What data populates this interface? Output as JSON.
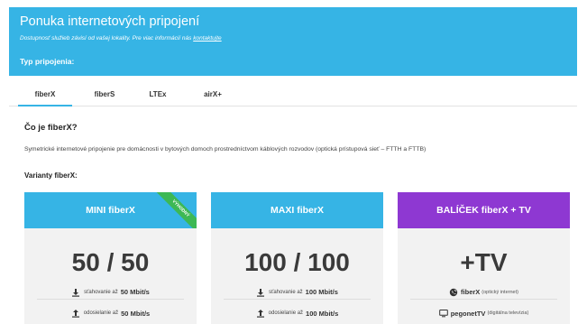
{
  "hero": {
    "title": "Ponuka internetových pripojení",
    "subtitle": "Dostupnosť služieb závisí od vašej lokality. Pre viac informácií nás",
    "contact_link": "kontaktujte",
    "type_label": "Typ pripojenia:"
  },
  "tabs": [
    {
      "label": "fiberX",
      "active": true
    },
    {
      "label": "fiberS",
      "active": false
    },
    {
      "label": "LTEx",
      "active": false
    },
    {
      "label": "airX+",
      "active": false
    }
  ],
  "content": {
    "heading": "Čo je fiberX?",
    "description": "Symetrické internetové pripojenie pre domácnosti v bytových domoch prostredníctvom káblových rozvodov (optická prístupová sieť – FTTH a FTTB)",
    "variants_label": "Varianty fiberX:"
  },
  "cards": [
    {
      "title": "MINI fiberX",
      "ribbon": "VÝHODNÝ",
      "big": "50 / 50",
      "color": "#36b4e5",
      "f1_label": "sťahovanie až",
      "f1_value": "50 Mbit/s",
      "f2_label": "odosielanie až",
      "f2_value": "50 Mbit/s"
    },
    {
      "title": "MAXI fiberX",
      "big": "100 / 100",
      "color": "#36b4e5",
      "f1_label": "sťahovanie až",
      "f1_value": "100 Mbit/s",
      "f2_label": "odosielanie až",
      "f2_value": "100 Mbit/s"
    },
    {
      "title": "BALÍČEK fiberX + TV",
      "big": "+TV",
      "color": "#8e38d2",
      "f1_value": "fiberX",
      "f1_note": "(optický internet)",
      "f2_value": "pegonetTV",
      "f2_note": "(digitálna televízia)"
    }
  ],
  "colors": {
    "accent": "#36b4e5",
    "purple": "#8e38d2",
    "ribbon": "#3db854"
  },
  "icons": [
    "download-icon",
    "upload-icon",
    "globe-icon",
    "tv-icon"
  ]
}
